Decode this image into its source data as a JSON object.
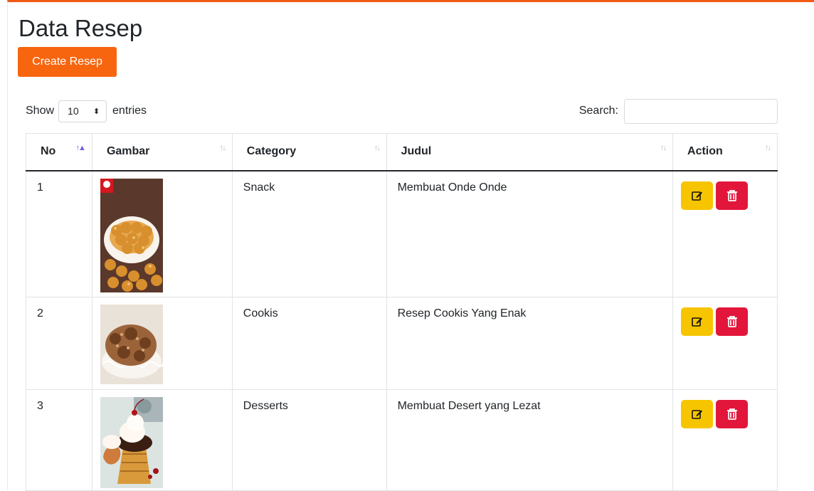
{
  "page": {
    "title": "Data Resep",
    "create_button": "Create Resep"
  },
  "controls": {
    "show_label": "Show",
    "entries_value": "10",
    "entries_suffix": "entries",
    "search_label": "Search:",
    "search_value": ""
  },
  "table": {
    "headers": [
      "No",
      "Gambar",
      "Category",
      "Judul",
      "Action"
    ],
    "rows": [
      {
        "no": "1",
        "image": "onde-onde-photo",
        "category": "Snack",
        "judul": "Membuat Onde Onde"
      },
      {
        "no": "2",
        "image": "cookies-photo",
        "category": "Cookis",
        "judul": "Resep Cookis Yang Enak"
      },
      {
        "no": "3",
        "image": "dessert-cupcake-photo",
        "category": "Desserts",
        "judul": "Membuat Desert yang Lezat"
      }
    ]
  },
  "colors": {
    "accent": "#f7650f",
    "edit": "#f6c500",
    "delete": "#e2163b",
    "header_border": "#23272b"
  },
  "icons": {
    "edit": "pencil-square-icon",
    "delete": "trash-icon",
    "sort": "sort-arrows-icon"
  }
}
